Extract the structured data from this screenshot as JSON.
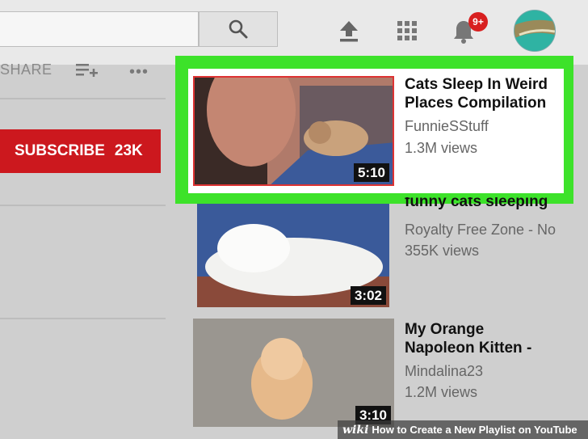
{
  "header": {
    "notification_count": "9+",
    "icons": [
      "search-icon",
      "upload-icon",
      "apps-grid-icon",
      "bell-icon",
      "avatar"
    ]
  },
  "channel": {
    "share_label": "SHARE",
    "subscribe_label": "SUBSCRIBE",
    "subscriber_count": "23K"
  },
  "videos": [
    {
      "title_line1": "Cats Sleep In Weird",
      "title_line2": "Places Compilation",
      "channel": "FunnieSStuff",
      "views": "1.3M views",
      "duration": "5:10"
    },
    {
      "title_line1": "funny cats sleeping",
      "title_line2": "",
      "channel": "Royalty Free Zone - No",
      "views": "355K views",
      "duration": "3:02"
    },
    {
      "title_line1": "My Orange",
      "title_line2": "Napoleon Kitten -",
      "channel": "Mindalina23",
      "views": "1.2M views",
      "duration": "3:10"
    }
  ],
  "watermark": {
    "logo": "wiki",
    "text": "How to Create a New Playlist on YouTube"
  },
  "colors": {
    "highlight": "#3de22a",
    "subscribe": "#cc181e",
    "badge": "#d81f1f"
  }
}
